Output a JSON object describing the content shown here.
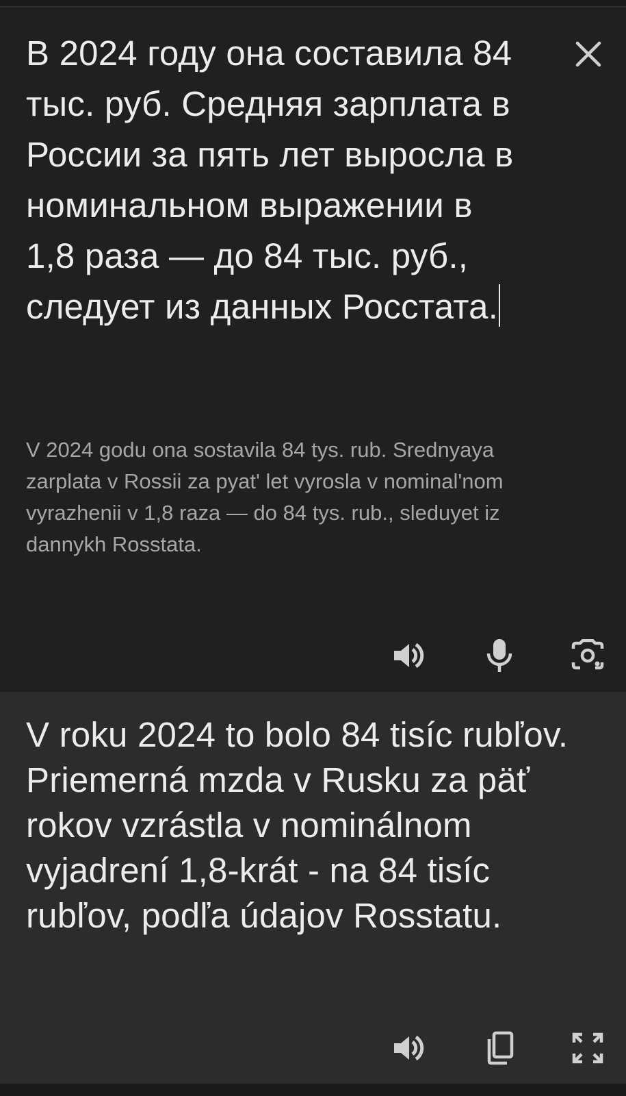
{
  "source": {
    "text": "В 2024 году она составила 84 тыс. руб. Средняя зарплата в России за пять лет выросла в номинальном выражении в 1,8 раза — до 84 тыс. руб., следует из данных Росстата.",
    "transliteration": "V 2024 godu ona sostavila 84 tys. rub. Srednyaya zarplata v Rossii za pyat' let vyrosla v nominal'nom vyrazhenii v 1,8 raza — do 84 tys. rub., sleduyet iz dannykh Rosstata.",
    "actions": [
      {
        "name": "listen",
        "icon": "speaker-icon"
      },
      {
        "name": "voice_input",
        "icon": "microphone-icon"
      },
      {
        "name": "camera_input",
        "icon": "camera-icon"
      }
    ],
    "close_icon": "close-icon"
  },
  "translation": {
    "text": "V roku 2024 to bolo 84 tisíc rubľov. Priemerná mzda v Rusku za päť rokov vzrástla v nominálnom vyjadrení 1,8-krát - na 84 tisíc rubľov, podľa údajov Rosstatu.",
    "actions": [
      {
        "name": "listen",
        "icon": "speaker-icon"
      },
      {
        "name": "copy",
        "icon": "copy-icon"
      },
      {
        "name": "fullscreen",
        "icon": "fullscreen-icon"
      }
    ]
  },
  "colors": {
    "source_bg": "#202021",
    "translation_bg": "#2c2c2f",
    "text": "#ececec",
    "secondary_text": "#a6a6a6",
    "icon": "#d0d0d0"
  }
}
